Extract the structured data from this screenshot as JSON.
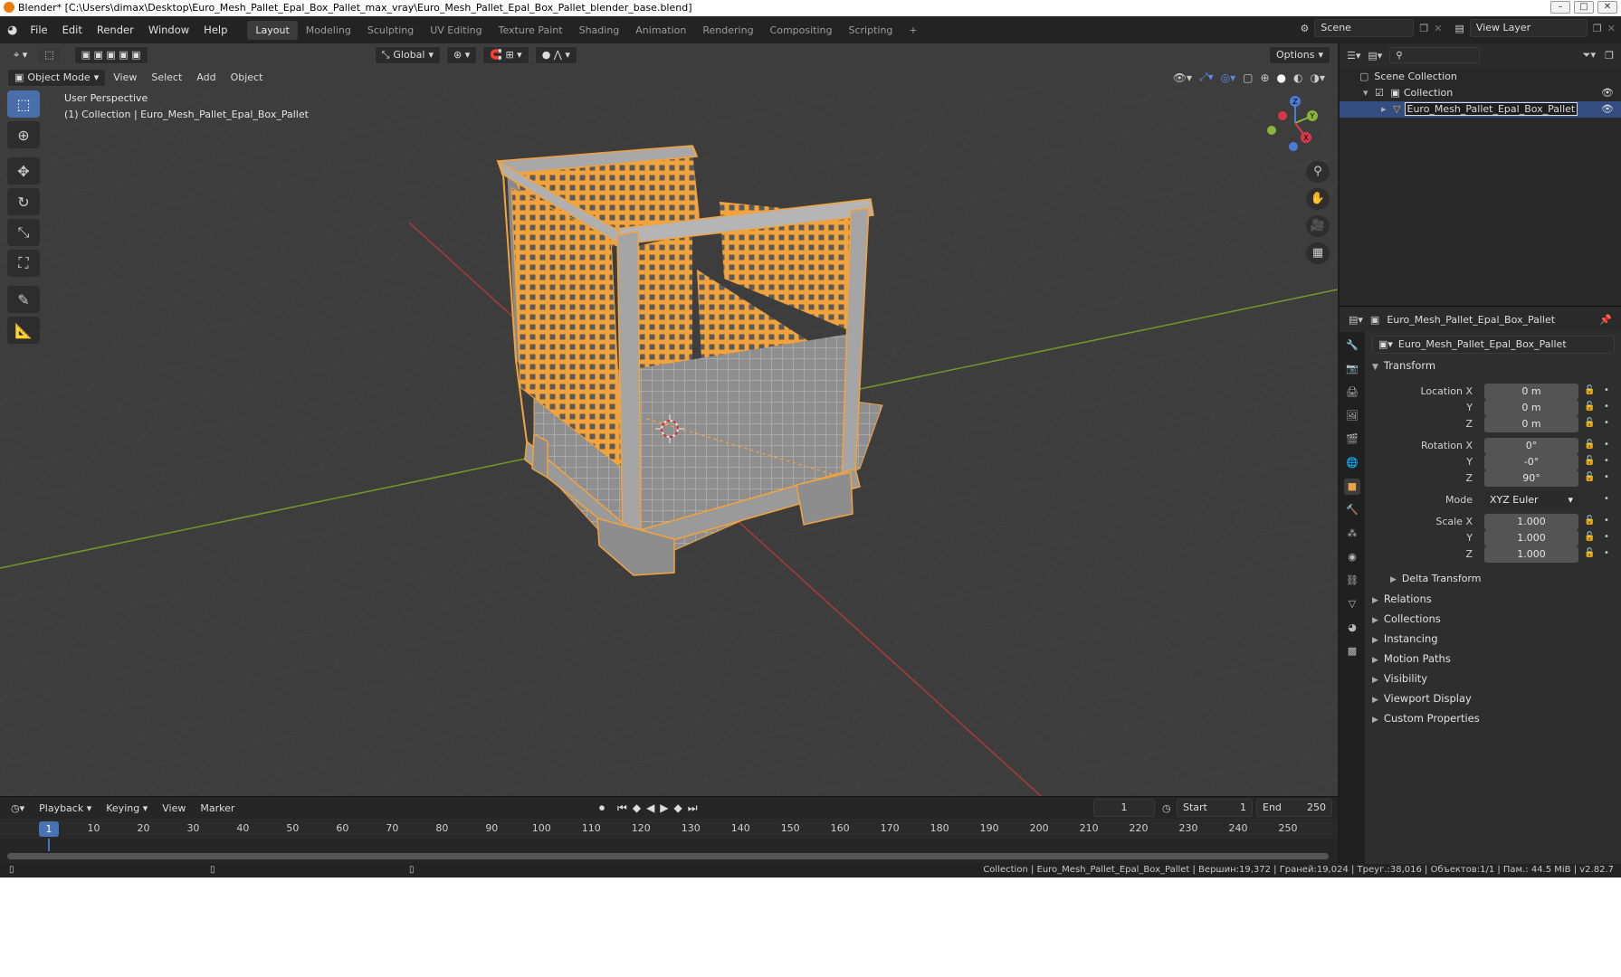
{
  "window": {
    "title": "Blender* [C:\\Users\\dimax\\Desktop\\Euro_Mesh_Pallet_Epal_Box_Pallet_max_vray\\Euro_Mesh_Pallet_Epal_Box_Pallet_blender_base.blend]"
  },
  "menu": [
    "File",
    "Edit",
    "Render",
    "Window",
    "Help"
  ],
  "workspaces": [
    "Layout",
    "Modeling",
    "Sculpting",
    "UV Editing",
    "Texture Paint",
    "Shading",
    "Animation",
    "Rendering",
    "Compositing",
    "Scripting"
  ],
  "active_workspace": "Layout",
  "scene": {
    "name": "Scene",
    "view_layer": "View Layer"
  },
  "viewport": {
    "transform_orientation": "Global",
    "options_label": "Options",
    "mode": "Object Mode",
    "menus": [
      "View",
      "Select",
      "Add",
      "Object"
    ],
    "overlay_line1": "User Perspective",
    "overlay_line2": "(1) Collection | Euro_Mesh_Pallet_Epal_Box_Pallet",
    "gizmo_axes": {
      "x": "X",
      "y": "Y",
      "z": "Z"
    }
  },
  "outliner": {
    "scene_collection": "Scene Collection",
    "collection": "Collection",
    "object": "Euro_Mesh_Pallet_Epal_Box_Pallet"
  },
  "properties": {
    "object_name": "Euro_Mesh_Pallet_Epal_Box_Pallet",
    "data_name": "Euro_Mesh_Pallet_Epal_Box_Pallet",
    "transform_label": "Transform",
    "location": {
      "label": "Location X",
      "x": "0 m",
      "y": "0 m",
      "z": "0 m"
    },
    "rotation": {
      "label": "Rotation X",
      "x": "0°",
      "y": "-0°",
      "z": "90°"
    },
    "mode_label": "Mode",
    "mode_value": "XYZ Euler",
    "scale": {
      "label": "Scale X",
      "x": "1.000",
      "y": "1.000",
      "z": "1.000"
    },
    "axis_y": "Y",
    "axis_z": "Z",
    "delta_transform": "Delta Transform",
    "panels": [
      "Relations",
      "Collections",
      "Instancing",
      "Motion Paths",
      "Visibility",
      "Viewport Display",
      "Custom Properties"
    ]
  },
  "timeline": {
    "menus": [
      "Playback",
      "Keying",
      "View",
      "Marker"
    ],
    "current_frame": "1",
    "start_label": "Start",
    "start": "1",
    "end_label": "End",
    "end": "250",
    "ruler_ticks": [
      "1",
      "10",
      "20",
      "30",
      "40",
      "50",
      "60",
      "70",
      "80",
      "90",
      "100",
      "110",
      "120",
      "130",
      "140",
      "150",
      "160",
      "170",
      "180",
      "190",
      "200",
      "210",
      "220",
      "230",
      "240",
      "250"
    ]
  },
  "status": {
    "text": "Collection | Euro_Mesh_Pallet_Epal_Box_Pallet | Вершин:19,372 | Граней:19,024 | Треуг.:38,016 | Объектов:1/1 | Пам.: 44.5 MiB | v2.82.7"
  },
  "colors": {
    "selection": "#f3a33b",
    "axis_x": "#a83b3b",
    "axis_y": "#6f9a2c",
    "active": "#4772b3"
  }
}
